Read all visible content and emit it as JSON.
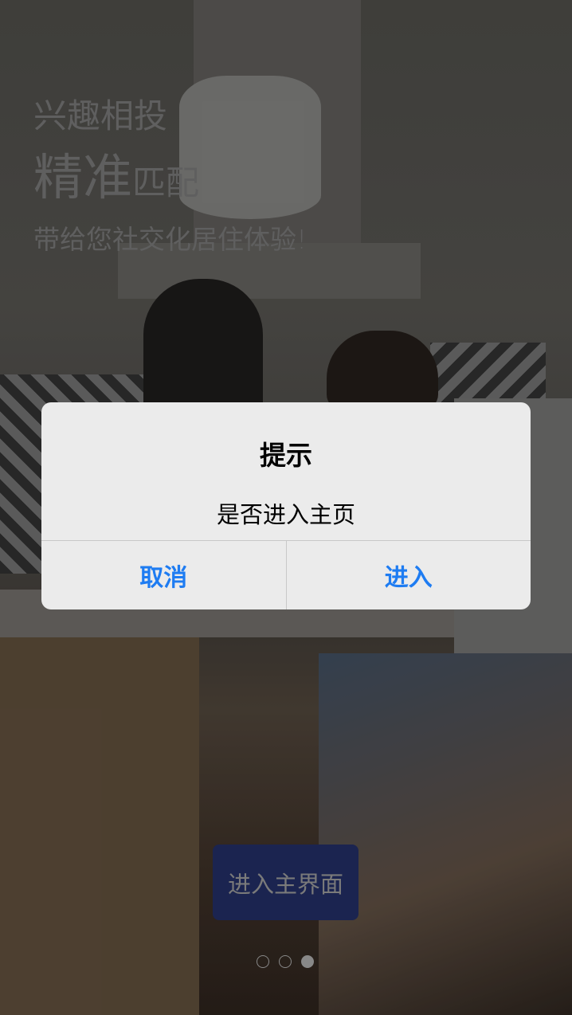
{
  "slogan": {
    "line1": "兴趣相投",
    "line2_big": "精准",
    "line2_small": "匹配",
    "line3": "带给您社交化居住体验!"
  },
  "enter_main_button": "进入主界面",
  "pager": {
    "count": 3,
    "active_index": 2
  },
  "dialog": {
    "title": "提示",
    "message": "是否进入主页",
    "cancel": "取消",
    "confirm": "进入",
    "button_color": "#1e7cf2"
  }
}
